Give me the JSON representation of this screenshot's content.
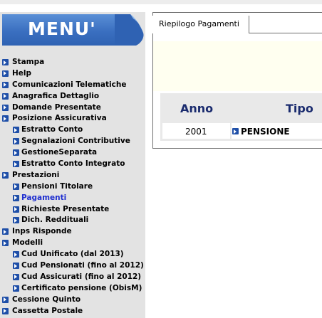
{
  "sidebar": {
    "menu_title": "MENU'",
    "items": [
      {
        "label": "Stampa",
        "level": 1
      },
      {
        "label": "Help",
        "level": 1
      },
      {
        "label": "Comunicazioni Telematiche",
        "level": 1
      },
      {
        "label": "Anagrafica Dettaglio",
        "level": 1
      },
      {
        "label": "Domande Presentate",
        "level": 1
      },
      {
        "label": "Posizione Assicurativa",
        "level": 1
      },
      {
        "label": "Estratto Conto",
        "level": 2
      },
      {
        "label": "Segnalazioni Contributive",
        "level": 2
      },
      {
        "label": "GestioneSeparata",
        "level": 2
      },
      {
        "label": "Estratto Conto Integrato",
        "level": 2
      },
      {
        "label": "Prestazioni",
        "level": 1
      },
      {
        "label": "Pensioni Titolare",
        "level": 2
      },
      {
        "label": "Pagamenti",
        "level": 2,
        "active": true
      },
      {
        "label": "Richieste Presentate",
        "level": 2
      },
      {
        "label": "Dich. Reddituali",
        "level": 2
      },
      {
        "label": "Inps Risponde",
        "level": 1
      },
      {
        "label": "Modelli",
        "level": 1
      },
      {
        "label": "Cud Unificato (dal 2013)",
        "level": 2
      },
      {
        "label": "Cud Pensionati (fino al 2012)",
        "level": 2
      },
      {
        "label": "Cud Assicurati (fino al 2012)",
        "level": 2
      },
      {
        "label": "Certificato pensione (ObisM)",
        "level": 2
      },
      {
        "label": "Cessione Quinto",
        "level": 1
      },
      {
        "label": "Cassetta Postale",
        "level": 1
      }
    ]
  },
  "main": {
    "tab_label": "Riepilogo Pagamenti",
    "table": {
      "headers": [
        "Anno",
        "Tipo"
      ],
      "rows": [
        {
          "anno": "2001",
          "tipo": "PENSIONE"
        }
      ]
    }
  },
  "colors": {
    "sidebar_bg": "#e3e3e3",
    "menu_banner": "#3a6fc0",
    "bullet": "#1f4fa8",
    "active_link": "#1f2fd0",
    "header_text": "#1a2b6e"
  }
}
